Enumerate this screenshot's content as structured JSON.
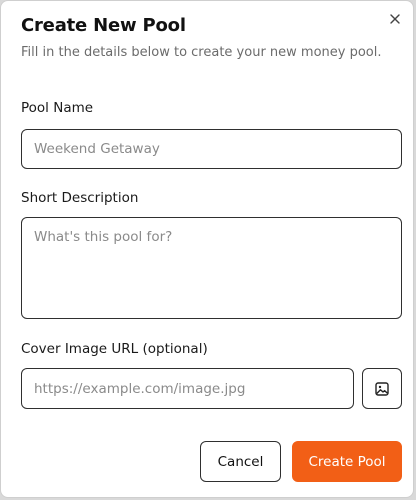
{
  "dialog": {
    "title": "Create New Pool",
    "subtitle": "Fill in the details below to create your new money pool.",
    "close_icon": "close-icon"
  },
  "form": {
    "pool_name": {
      "label": "Pool Name",
      "value": "",
      "placeholder": "Weekend Getaway"
    },
    "short_description": {
      "label": "Short Description",
      "value": "",
      "placeholder": "What's this pool for?"
    },
    "cover_image_url": {
      "label": "Cover Image URL (optional)",
      "value": "",
      "placeholder": "https://example.com/image.jpg",
      "image_button_icon": "image-icon"
    }
  },
  "actions": {
    "cancel_label": "Cancel",
    "create_label": "Create Pool"
  },
  "colors": {
    "accent": "#f25f16",
    "border": "#2f2f2f",
    "muted_text": "#6b6b6b"
  }
}
